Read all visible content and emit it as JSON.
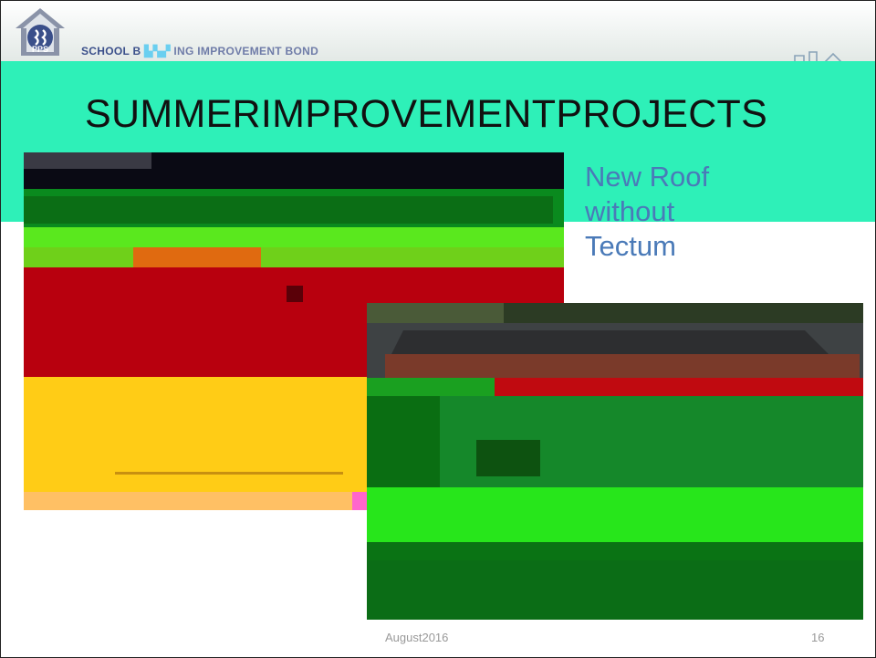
{
  "header": {
    "logo_text": "PPS",
    "bond_name_part1": "SCHOOL B",
    "bond_name_part2": "ING IMPROVEMENT BOND"
  },
  "slide": {
    "title": "SUMMERIMPROVEMENTPROJECTS",
    "caption_lines": [
      "New Roof",
      "without",
      "Tectum"
    ]
  },
  "footer": {
    "date": "August2016",
    "page_number": "16"
  },
  "colors": {
    "title_band": "#2ef0b8",
    "caption": "#4a7ab8",
    "bond_text": "#3a4f8a"
  }
}
